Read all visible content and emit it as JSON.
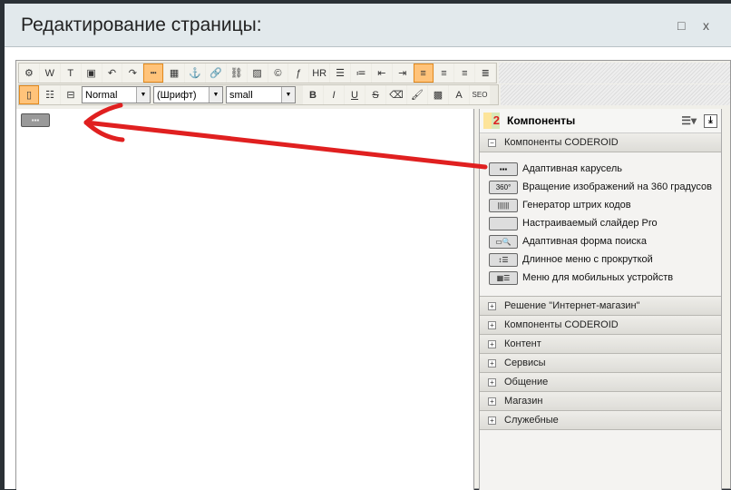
{
  "window": {
    "title": "Редактирование страницы:",
    "maximize_icon": "□",
    "close_icon": "x"
  },
  "toolbar": {
    "row1": [
      {
        "name": "settings-icon",
        "glyph": "⚙"
      },
      {
        "name": "paste-word-icon",
        "glyph": "W"
      },
      {
        "name": "paste-text-icon",
        "glyph": "T"
      },
      {
        "name": "select-all-icon",
        "glyph": "▣"
      },
      {
        "name": "undo-icon",
        "glyph": "↶"
      },
      {
        "name": "redo-icon",
        "glyph": "↷"
      },
      {
        "name": "page-break-icon",
        "glyph": "┅",
        "active": true
      },
      {
        "name": "table-icon",
        "glyph": "▦"
      },
      {
        "name": "anchor-icon",
        "glyph": "⚓"
      },
      {
        "name": "link-icon",
        "glyph": "🔗"
      },
      {
        "name": "unlink-icon",
        "glyph": "⛓"
      },
      {
        "name": "image-icon",
        "glyph": "▨"
      },
      {
        "name": "copyright-icon",
        "glyph": "©"
      },
      {
        "name": "flash-icon",
        "glyph": "ƒ"
      },
      {
        "name": "hr-icon",
        "glyph": "HR"
      },
      {
        "name": "ordered-list-icon",
        "glyph": "☰"
      },
      {
        "name": "unordered-list-icon",
        "glyph": "≔"
      },
      {
        "name": "outdent-icon",
        "glyph": "⇤"
      },
      {
        "name": "indent-icon",
        "glyph": "⇥"
      },
      {
        "name": "align-left-icon",
        "glyph": "≡",
        "active": true
      },
      {
        "name": "align-center-icon",
        "glyph": "≡"
      },
      {
        "name": "align-right-icon",
        "glyph": "≡"
      },
      {
        "name": "justify-icon",
        "glyph": "≣"
      }
    ],
    "row2_modes": [
      {
        "name": "wysiwyg-mode-icon",
        "glyph": "▯",
        "active": true
      },
      {
        "name": "code-mode-icon",
        "glyph": "☷"
      },
      {
        "name": "split-mode-icon",
        "glyph": "⊟"
      }
    ],
    "style_select": "Normal",
    "font_select": "(Шрифт)",
    "size_select": "small",
    "row2_format": [
      {
        "name": "bold-icon",
        "glyph": "B"
      },
      {
        "name": "italic-icon",
        "glyph": "I"
      },
      {
        "name": "underline-icon",
        "glyph": "U"
      },
      {
        "name": "strike-icon",
        "glyph": "S"
      },
      {
        "name": "eraser-icon",
        "glyph": "⌫"
      },
      {
        "name": "brush-icon",
        "glyph": "🖌"
      },
      {
        "name": "text-color-icon",
        "glyph": "▩"
      },
      {
        "name": "bg-color-icon",
        "glyph": "A"
      },
      {
        "name": "seo-icon",
        "glyph": "SEO"
      }
    ]
  },
  "panel": {
    "title": "Компоненты",
    "open_group": "Компоненты CODEROID",
    "items": [
      {
        "label": "Адаптивная карусель",
        "icon": "carousel-icon",
        "glyph": "▪▪▪"
      },
      {
        "label": "Вращение изображений на 360 градусов",
        "icon": "rotate-360-icon",
        "glyph": "360°"
      },
      {
        "label": "Генератор штрих кодов",
        "icon": "barcode-icon",
        "glyph": "||||||"
      },
      {
        "label": "Настраиваемый слайдер Pro",
        "icon": "slider-icon",
        "glyph": ""
      },
      {
        "label": "Адаптивная форма поиска",
        "icon": "search-form-icon",
        "glyph": "▭🔍"
      },
      {
        "label": "Длинное меню с прокруткой",
        "icon": "scroll-menu-icon",
        "glyph": "↕☰"
      },
      {
        "label": "Меню для мобильных устройств",
        "icon": "mobile-menu-icon",
        "glyph": "▦☰"
      }
    ],
    "groups": [
      "Решение \"Интернет-магазин\"",
      "Компоненты CODEROID",
      "Контент",
      "Сервисы",
      "Общение",
      "Магазин",
      "Служебные"
    ]
  },
  "colors": {
    "annotation_arrow": "#e02020",
    "active_button": "#ffc37a"
  }
}
